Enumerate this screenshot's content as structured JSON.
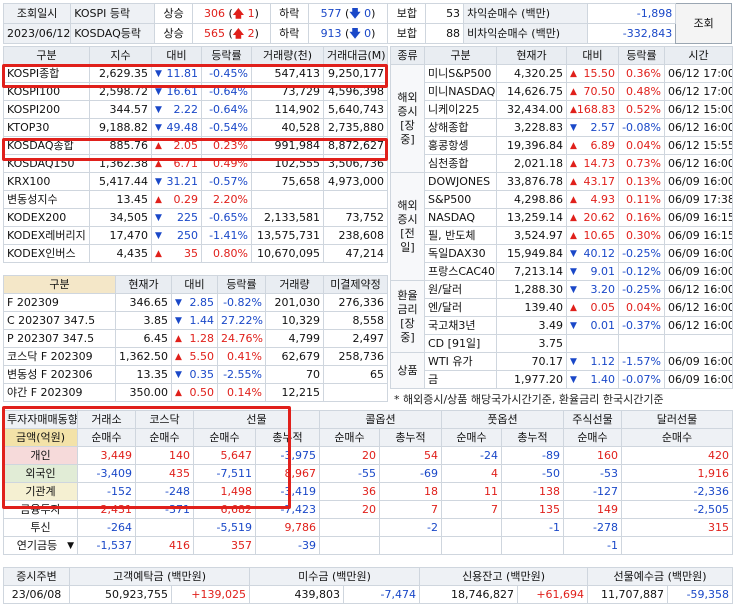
{
  "top": {
    "label1": "조회일시",
    "date": "2023/06/12",
    "rows": [
      {
        "name": "KOSPI 등락",
        "up_label": "상승",
        "up": "306",
        "upper_limit": "1",
        "down_label": "하락",
        "down": "577",
        "lower_limit": "0",
        "flat_label": "보합",
        "flat": "53",
        "net_label": "차익순매수 (백만)",
        "net": "-1,898"
      },
      {
        "name": "KOSDAQ등락",
        "up_label": "상승",
        "up": "565",
        "upper_limit": "2",
        "down_label": "하락",
        "down": "913",
        "lower_limit": "0",
        "flat_label": "보합",
        "flat": "88",
        "net_label": "비차익순매수 (백만)",
        "net": "-332,843"
      }
    ],
    "query_button": "조회"
  },
  "index_table": {
    "headers": [
      "구분",
      "지수",
      "대비",
      "등락률",
      "거래량(천)",
      "거래대금(M)"
    ],
    "rows": [
      {
        "name": "KOSPI종합",
        "value": "2,629.35",
        "dir": "dn",
        "chg": "11.81",
        "pct": "-0.45%",
        "vol": "547,413",
        "amt": "9,250,177"
      },
      {
        "name": "KOSPI100",
        "value": "2,598.72",
        "dir": "dn",
        "chg": "16.61",
        "pct": "-0.64%",
        "vol": "73,729",
        "amt": "4,596,398"
      },
      {
        "name": "KOSPI200",
        "value": "344.57",
        "dir": "dn",
        "chg": "2.22",
        "pct": "-0.64%",
        "vol": "114,902",
        "amt": "5,640,743"
      },
      {
        "name": "KTOP30",
        "value": "9,188.82",
        "dir": "dn",
        "chg": "49.48",
        "pct": "-0.54%",
        "vol": "40,528",
        "amt": "2,735,880"
      },
      {
        "name": "KOSDAQ종합",
        "value": "885.76",
        "dir": "up",
        "chg": "2.05",
        "pct": "0.23%",
        "vol": "991,984",
        "amt": "8,872,627"
      },
      {
        "name": "KOSDAQ150",
        "value": "1,362.38",
        "dir": "up",
        "chg": "6.71",
        "pct": "0.49%",
        "vol": "102,555",
        "amt": "3,506,736"
      },
      {
        "name": "KRX100",
        "value": "5,417.44",
        "dir": "dn",
        "chg": "31.21",
        "pct": "-0.57%",
        "vol": "75,658",
        "amt": "4,973,000"
      },
      {
        "name": "변동성지수",
        "value": "13.45",
        "dir": "up",
        "chg": "0.29",
        "pct": "2.20%",
        "vol": "",
        "amt": ""
      },
      {
        "name": "KODEX200",
        "value": "34,505",
        "dir": "dn",
        "chg": "225",
        "pct": "-0.65%",
        "vol": "2,133,581",
        "amt": "73,752"
      },
      {
        "name": "KODEX레버리지",
        "value": "17,470",
        "dir": "dn",
        "chg": "250",
        "pct": "-1.41%",
        "vol": "13,575,731",
        "amt": "238,608"
      },
      {
        "name": "KODEX인버스",
        "value": "4,435",
        "dir": "up",
        "chg": "35",
        "pct": "0.80%",
        "vol": "10,670,095",
        "amt": "47,214"
      }
    ]
  },
  "futures_table": {
    "headers": [
      "구분",
      "현재가",
      "대비",
      "등락률",
      "거래량",
      "미결제약정"
    ],
    "rows": [
      {
        "name": "F 202309",
        "value": "346.65",
        "dir": "dn",
        "chg": "2.85",
        "pct": "-0.82%",
        "vol": "201,030",
        "oi": "276,336"
      },
      {
        "name": "C 202307 347.5",
        "value": "3.85",
        "dir": "dn",
        "chg": "1.44",
        "pct": "27.22%",
        "vol": "10,329",
        "oi": "8,558"
      },
      {
        "name": "P 202307 347.5",
        "value": "6.45",
        "dir": "up",
        "chg": "1.28",
        "pct": "24.76%",
        "vol": "4,799",
        "oi": "2,497"
      },
      {
        "name": "코스닥 F 202309",
        "value": "1,362.50",
        "dir": "up",
        "chg": "5.50",
        "pct": "0.41%",
        "vol": "62,679",
        "oi": "258,736"
      },
      {
        "name": "변동성 F 202306",
        "value": "13.35",
        "dir": "dn",
        "chg": "0.35",
        "pct": "-2.55%",
        "vol": "70",
        "oi": "65"
      },
      {
        "name": "야간 F 202309",
        "value": "350.00",
        "dir": "up",
        "chg": "0.50",
        "pct": "0.14%",
        "vol": "12,215",
        "oi": ""
      }
    ]
  },
  "world_table": {
    "headers": [
      "종류",
      "구분",
      "현재가",
      "대비",
      "등락률",
      "시간"
    ],
    "groups": [
      {
        "label": "해외\n증시\n[장중]",
        "rows": [
          {
            "name": "미니S&P500",
            "value": "4,320.25",
            "dir": "up",
            "chg": "15.50",
            "pct": "0.36%",
            "time": "06/12 17:00"
          },
          {
            "name": "미니NASDAQ",
            "value": "14,626.75",
            "dir": "up",
            "chg": "70.50",
            "pct": "0.48%",
            "time": "06/12 17:00"
          },
          {
            "name": "니케이225",
            "value": "32,434.00",
            "dir": "up",
            "chg": "168.83",
            "pct": "0.52%",
            "time": "06/12 15:00"
          },
          {
            "name": "상해종합",
            "value": "3,228.83",
            "dir": "dn",
            "chg": "2.57",
            "pct": "-0.08%",
            "time": "06/12 16:00"
          },
          {
            "name": "홍콩항셍",
            "value": "19,396.84",
            "dir": "up",
            "chg": "6.89",
            "pct": "0.04%",
            "time": "06/12 15:55"
          },
          {
            "name": "심천종합",
            "value": "2,021.18",
            "dir": "up",
            "chg": "14.73",
            "pct": "0.73%",
            "time": "06/12 16:00"
          }
        ]
      },
      {
        "label": "해외\n증시\n[전일]",
        "rows": [
          {
            "name": "DOWJONES",
            "value": "33,876.78",
            "dir": "up",
            "chg": "43.17",
            "pct": "0.13%",
            "time": "06/09 16:00"
          },
          {
            "name": "S&P500",
            "value": "4,298.86",
            "dir": "up",
            "chg": "4.93",
            "pct": "0.11%",
            "time": "06/09 17:38"
          },
          {
            "name": "NASDAQ",
            "value": "13,259.14",
            "dir": "up",
            "chg": "20.62",
            "pct": "0.16%",
            "time": "06/09 16:15"
          },
          {
            "name": "필, 반도체",
            "value": "3,524.97",
            "dir": "up",
            "chg": "10.65",
            "pct": "0.30%",
            "time": "06/09 16:15"
          },
          {
            "name": "독일DAX30",
            "value": "15,949.84",
            "dir": "dn",
            "chg": "40.12",
            "pct": "-0.25%",
            "time": "06/09 16:00"
          },
          {
            "name": "프랑스CAC40",
            "value": "7,213.14",
            "dir": "dn",
            "chg": "9.01",
            "pct": "-0.12%",
            "time": "06/09 16:00"
          }
        ]
      },
      {
        "label": "환율\n금리\n[장중]",
        "rows": [
          {
            "name": "원/달러",
            "value": "1,288.30",
            "dir": "dn",
            "chg": "3.20",
            "pct": "-0.25%",
            "time": "06/12 16:00"
          },
          {
            "name": "엔/달러",
            "value": "139.40",
            "dir": "up",
            "chg": "0.05",
            "pct": "0.04%",
            "time": "06/12 16:00"
          },
          {
            "name": "국고채3년",
            "value": "3.49",
            "dir": "dn",
            "chg": "0.01",
            "pct": "-0.37%",
            "time": "06/12 16:00"
          },
          {
            "name": "CD [91일]",
            "value": "3.75",
            "dir": "",
            "chg": "",
            "pct": "",
            "time": ""
          }
        ]
      },
      {
        "label": "상품",
        "rows": [
          {
            "name": "WTI 유가",
            "value": "70.17",
            "dir": "dn",
            "chg": "1.12",
            "pct": "-1.57%",
            "time": "06/09 16:00"
          },
          {
            "name": "금",
            "value": "1,977.20",
            "dir": "dn",
            "chg": "1.40",
            "pct": "-0.07%",
            "time": "06/09 16:00"
          }
        ]
      }
    ],
    "note": "* 해외증시/상품 해당국가시간기준, 환율금리 한국시간기준"
  },
  "investor_table": {
    "header_top": [
      "투자자매매동향",
      "거래소",
      "코스닥",
      "선물",
      "콜옵션",
      "풋옵션",
      "주식선물",
      "달러선물"
    ],
    "header_sub": [
      "금액(억원)",
      "순매수",
      "순매수",
      "순매수",
      "총누적",
      "순매수",
      "총누적",
      "순매수",
      "총누적",
      "순매수",
      "순매수"
    ],
    "rows": [
      {
        "name": "개인",
        "v": [
          "3,449",
          "140",
          "5,647",
          "-3,975",
          "20",
          "54",
          "-24",
          "-89",
          "160",
          "420"
        ]
      },
      {
        "name": "외국인",
        "v": [
          "-3,409",
          "435",
          "-7,511",
          "8,967",
          "-55",
          "-69",
          "4",
          "-50",
          "-53",
          "1,916"
        ]
      },
      {
        "name": "기관계",
        "v": [
          "-152",
          "-248",
          "1,498",
          "-3,419",
          "36",
          "18",
          "11",
          "138",
          "-127",
          "-2,336"
        ]
      },
      {
        "name": "금융투자",
        "v": [
          "2,431",
          "-371",
          "6,682",
          "-7,423",
          "20",
          "7",
          "7",
          "135",
          "149",
          "-2,505"
        ]
      },
      {
        "name": "투신",
        "v": [
          "-264",
          "",
          "-5,519",
          "9,786",
          "",
          "-2",
          "",
          "-1",
          "-278",
          "315"
        ]
      },
      {
        "name": "연기금등",
        "v": [
          "-1,537",
          "416",
          "357",
          "-39",
          "",
          "",
          "",
          "",
          "-1",
          ""
        ]
      }
    ]
  },
  "bottom": {
    "label": "증시주변",
    "date": "23/06/08",
    "items": [
      {
        "label": "고객예탁금 (백만원)",
        "value": "50,923,755",
        "chg": "+139,025"
      },
      {
        "label": "미수금 (백만원)",
        "value": "439,803",
        "chg": "-7,474"
      },
      {
        "label": "신용잔고 (백만원)",
        "value": "18,746,827",
        "chg": "+61,694"
      },
      {
        "label": "선물예수금 (백만원)",
        "value": "11,707,887",
        "chg": "-59,358"
      }
    ]
  }
}
